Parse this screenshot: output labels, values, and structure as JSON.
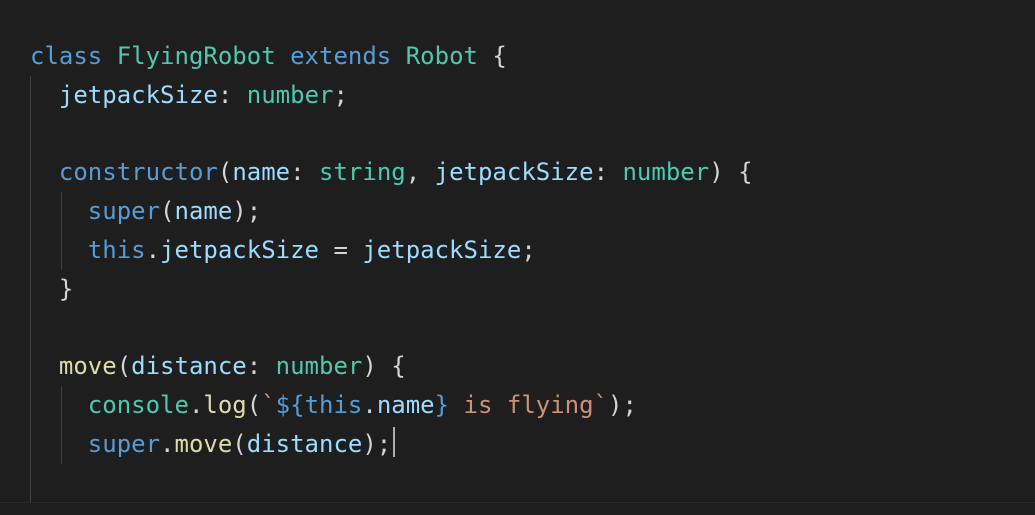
{
  "colors": {
    "background": "#1e1e1e",
    "keyword": "#569cd6",
    "type": "#4ec9b0",
    "property": "#9cdcfe",
    "function": "#dcdcaa",
    "string": "#ce9178",
    "punctuation": "#d4d4d4",
    "template_punct": "#569cd6"
  },
  "lines": [
    {
      "indent": 0,
      "tokens": [
        {
          "text": "class",
          "kind": "keyword"
        },
        {
          "text": " ",
          "kind": "punctuation"
        },
        {
          "text": "FlyingRobot",
          "kind": "type"
        },
        {
          "text": " ",
          "kind": "punctuation"
        },
        {
          "text": "extends",
          "kind": "keyword"
        },
        {
          "text": " ",
          "kind": "punctuation"
        },
        {
          "text": "Robot",
          "kind": "type"
        },
        {
          "text": " {",
          "kind": "punctuation"
        }
      ]
    },
    {
      "indent": 1,
      "tokens": [
        {
          "text": "jetpackSize",
          "kind": "property"
        },
        {
          "text": ": ",
          "kind": "punctuation"
        },
        {
          "text": "number",
          "kind": "type"
        },
        {
          "text": ";",
          "kind": "punctuation"
        }
      ]
    },
    {
      "indent": 1,
      "tokens": []
    },
    {
      "indent": 1,
      "tokens": [
        {
          "text": "constructor",
          "kind": "keyword"
        },
        {
          "text": "(",
          "kind": "punctuation"
        },
        {
          "text": "name",
          "kind": "property"
        },
        {
          "text": ": ",
          "kind": "punctuation"
        },
        {
          "text": "string",
          "kind": "type"
        },
        {
          "text": ", ",
          "kind": "punctuation"
        },
        {
          "text": "jetpackSize",
          "kind": "property"
        },
        {
          "text": ": ",
          "kind": "punctuation"
        },
        {
          "text": "number",
          "kind": "type"
        },
        {
          "text": ") {",
          "kind": "punctuation"
        }
      ]
    },
    {
      "indent": 2,
      "tokens": [
        {
          "text": "super",
          "kind": "keyword"
        },
        {
          "text": "(",
          "kind": "punctuation"
        },
        {
          "text": "name",
          "kind": "property"
        },
        {
          "text": ");",
          "kind": "punctuation"
        }
      ]
    },
    {
      "indent": 2,
      "tokens": [
        {
          "text": "this",
          "kind": "keyword"
        },
        {
          "text": ".",
          "kind": "punctuation"
        },
        {
          "text": "jetpackSize",
          "kind": "property"
        },
        {
          "text": " = ",
          "kind": "punctuation"
        },
        {
          "text": "jetpackSize",
          "kind": "property"
        },
        {
          "text": ";",
          "kind": "punctuation"
        }
      ]
    },
    {
      "indent": 1,
      "tokens": [
        {
          "text": "}",
          "kind": "punctuation"
        }
      ]
    },
    {
      "indent": 1,
      "tokens": []
    },
    {
      "indent": 1,
      "tokens": [
        {
          "text": "move",
          "kind": "function"
        },
        {
          "text": "(",
          "kind": "punctuation"
        },
        {
          "text": "distance",
          "kind": "property"
        },
        {
          "text": ": ",
          "kind": "punctuation"
        },
        {
          "text": "number",
          "kind": "type"
        },
        {
          "text": ") {",
          "kind": "punctuation"
        }
      ]
    },
    {
      "indent": 2,
      "tokens": [
        {
          "text": "console",
          "kind": "type"
        },
        {
          "text": ".",
          "kind": "punctuation"
        },
        {
          "text": "log",
          "kind": "function"
        },
        {
          "text": "(",
          "kind": "punctuation"
        },
        {
          "text": "`",
          "kind": "string"
        },
        {
          "text": "${",
          "kind": "template_punct"
        },
        {
          "text": "this",
          "kind": "keyword"
        },
        {
          "text": ".",
          "kind": "punctuation"
        },
        {
          "text": "name",
          "kind": "property"
        },
        {
          "text": "}",
          "kind": "template_punct"
        },
        {
          "text": " is flying`",
          "kind": "string"
        },
        {
          "text": ");",
          "kind": "punctuation"
        }
      ]
    },
    {
      "indent": 2,
      "cursor": true,
      "tokens": [
        {
          "text": "super",
          "kind": "keyword"
        },
        {
          "text": ".",
          "kind": "punctuation"
        },
        {
          "text": "move",
          "kind": "function"
        },
        {
          "text": "(",
          "kind": "punctuation"
        },
        {
          "text": "distance",
          "kind": "property"
        },
        {
          "text": ");",
          "kind": "punctuation"
        }
      ]
    },
    {
      "indent": 1,
      "tokens": []
    }
  ]
}
